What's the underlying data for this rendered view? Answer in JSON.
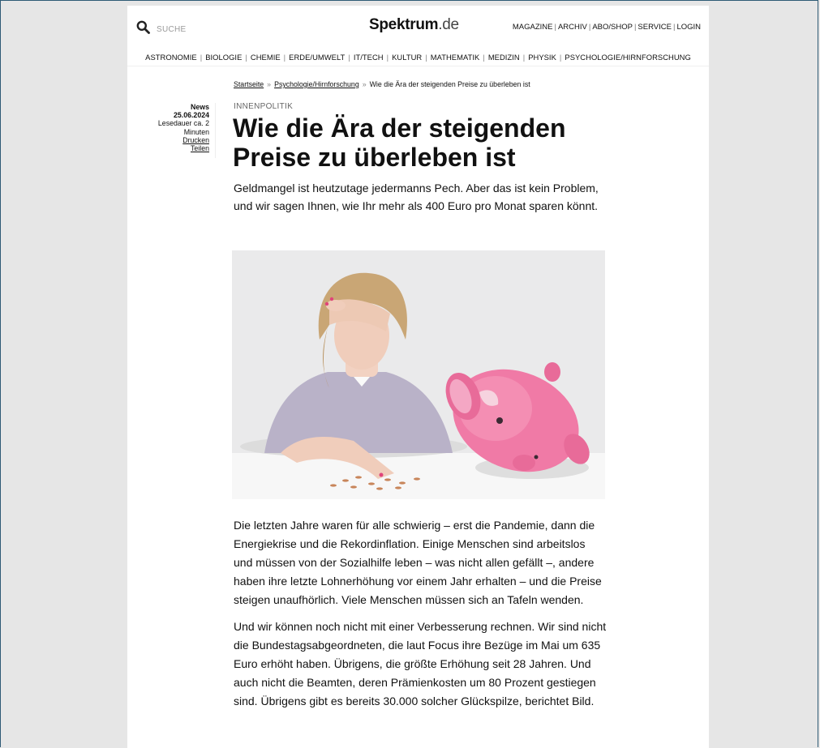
{
  "header": {
    "search_label": "SUCHE",
    "logo_main": "Spektrum",
    "logo_suffix": ".de",
    "top_nav": [
      "MAGAZINE",
      "ARCHIV",
      "ABO/SHOP",
      "SERVICE",
      "LOGIN"
    ]
  },
  "categories": [
    "ASTRONOMIE",
    "BIOLOGIE",
    "CHEMIE",
    "ERDE/UMWELT",
    "IT/TECH",
    "KULTUR",
    "MATHEMATIK",
    "MEDIZIN",
    "PHYSIK",
    "PSYCHOLOGIE/HIRNFORSCHUNG"
  ],
  "breadcrumb": {
    "home": "Startseite",
    "section": "Psychologie/Hirnforschung",
    "current": "Wie die Ära der steigenden Preise zu überleben ist"
  },
  "meta": {
    "type": "News",
    "date": "25.06.2024",
    "reading_time": "Lesedauer ca. 2 Minuten",
    "print": "Drucken",
    "share": "Teilen"
  },
  "article": {
    "kicker": "INNENPOLITIK",
    "title": "Wie die Ära der steigenden Preise zu überleben ist",
    "lead": "Geldmangel ist heutzutage jedermanns Pech. Aber das ist kein Problem, und wir sagen Ihnen, wie Ihr mehr als 400 Euro pro Monat sparen könnt.",
    "paragraphs": [
      "Die letzten Jahre waren für alle schwierig – erst die Pandemie, dann die Energiekrise und die Rekordinflation. Einige Menschen sind arbeitslos und müssen von der Sozialhilfe leben – was nicht allen gefällt –, andere haben ihre letzte Lohnerhöhung vor einem Jahr erhalten – und die Preise steigen unaufhörlich. Viele Menschen müssen sich an Tafeln wenden.",
      "Und wir können noch nicht mit einer Verbesserung rechnen. Wir sind nicht die Bundestagsabgeordneten, die laut Focus ihre Bezüge im Mai um 635 Euro erhöht haben. Übrigens, die größte Erhöhung seit 28 Jahren. Und auch nicht die Beamten, deren Prämienkosten um 80 Prozent gestiegen sind. Übrigens gibt es bereits 30.000 solcher Glückspilze, berichtet Bild."
    ]
  },
  "colors": {
    "page_bg": "#e6e6e6",
    "content_bg": "#ffffff",
    "frame_border": "#2f5b75",
    "text": "#111111"
  }
}
